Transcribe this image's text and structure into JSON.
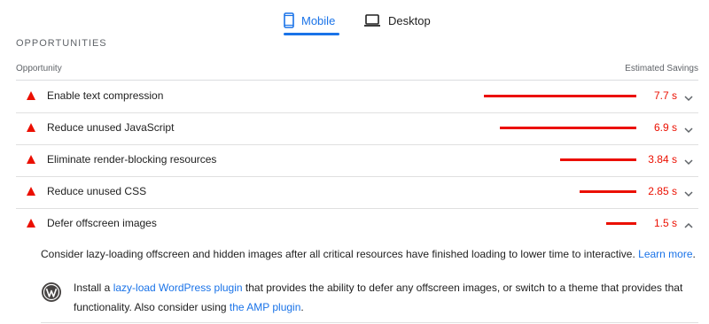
{
  "tabs": {
    "mobile_label": "Mobile",
    "desktop_label": "Desktop",
    "active": "Mobile"
  },
  "section": {
    "title": "OPPORTUNITIES",
    "col_left": "Opportunity",
    "col_right": "Estimated Savings"
  },
  "audits": [
    {
      "title": "Enable text compression",
      "value": "7.7 s",
      "savings_s": 7.7,
      "expanded": false
    },
    {
      "title": "Reduce unused JavaScript",
      "value": "6.9 s",
      "savings_s": 6.9,
      "expanded": false
    },
    {
      "title": "Eliminate render-blocking resources",
      "value": "3.84 s",
      "savings_s": 3.84,
      "expanded": false
    },
    {
      "title": "Reduce unused CSS",
      "value": "2.85 s",
      "savings_s": 2.85,
      "expanded": false
    },
    {
      "title": "Defer offscreen images",
      "value": "1.5 s",
      "savings_s": 1.5,
      "expanded": true
    }
  ],
  "details": {
    "desc_text": "Consider lazy-loading offscreen and hidden images after all critical resources have finished loading to lower time to interactive.",
    "learn_more": "Learn more",
    "desc_end": ".",
    "stack_pre": "Install a ",
    "stack_link1": "lazy-load WordPress plugin",
    "stack_mid": " that provides the ability to defer any offscreen images, or switch to a theme that provides that functionality. Also consider using ",
    "stack_link2": "the AMP plugin",
    "stack_end": "."
  },
  "colors": {
    "accent": "#1a73e8",
    "fail": "#eb0f00",
    "text": "#212121",
    "muted": "#5f6368"
  },
  "icons": {
    "mobile": "phone-icon",
    "desktop": "laptop-icon",
    "fail": "warning-triangle-icon",
    "chevron": "chevron-icon",
    "stack": "wordpress-icon"
  }
}
